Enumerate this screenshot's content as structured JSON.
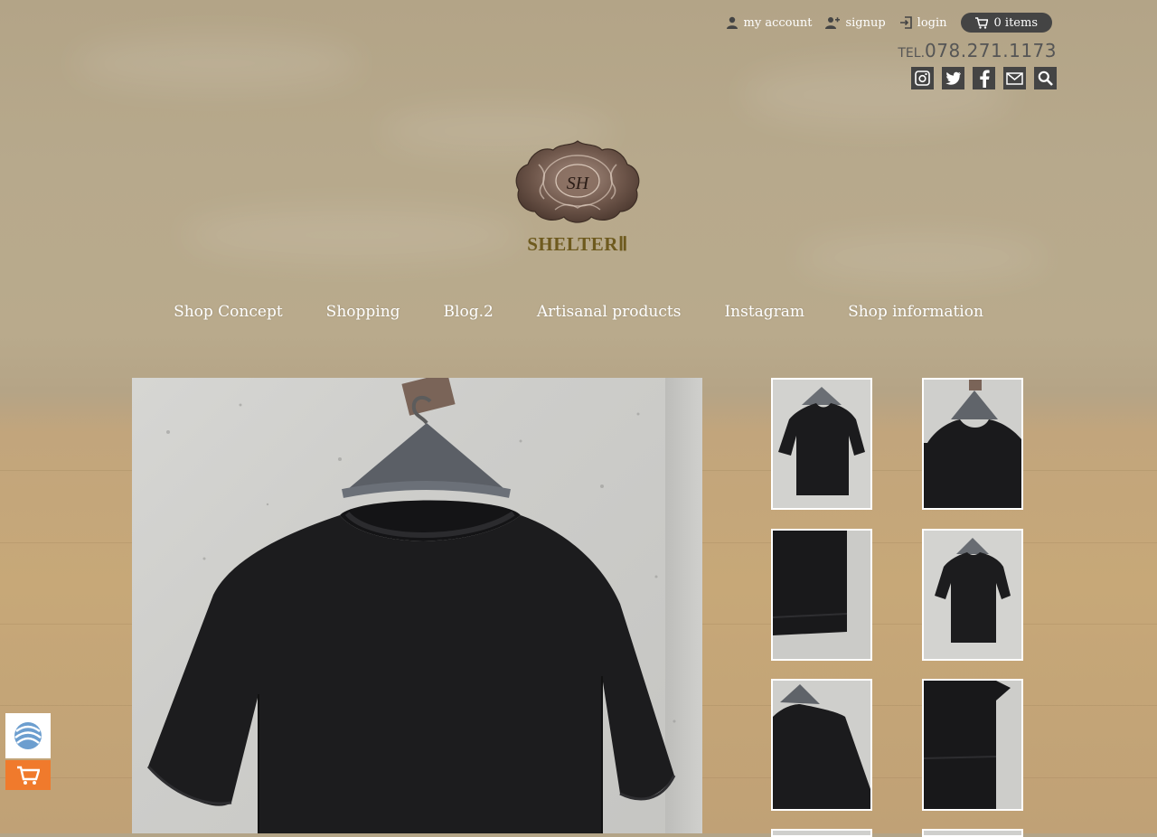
{
  "header": {
    "links": [
      {
        "label": "my account",
        "icon": "user-icon"
      },
      {
        "label": "signup",
        "icon": "user-plus-icon"
      },
      {
        "label": "login",
        "icon": "login-icon"
      }
    ],
    "cart_label": "0 items",
    "tel_prefix": "TEL.",
    "tel_number": "078.271.1173",
    "socials": [
      "instagram-icon",
      "twitter-icon",
      "facebook-icon",
      "mail-icon",
      "search-icon"
    ]
  },
  "logo": {
    "monogram": "SH",
    "name": "SHELTERⅡ"
  },
  "nav": {
    "items": [
      "Shop Concept",
      "Shopping",
      "Blog.2",
      "Artisanal products",
      "Instagram",
      "Shop information"
    ]
  },
  "colors": {
    "accent_dark": "#444444",
    "side_cart": "#f07a2c",
    "logo_text": "#6e5a1e"
  }
}
